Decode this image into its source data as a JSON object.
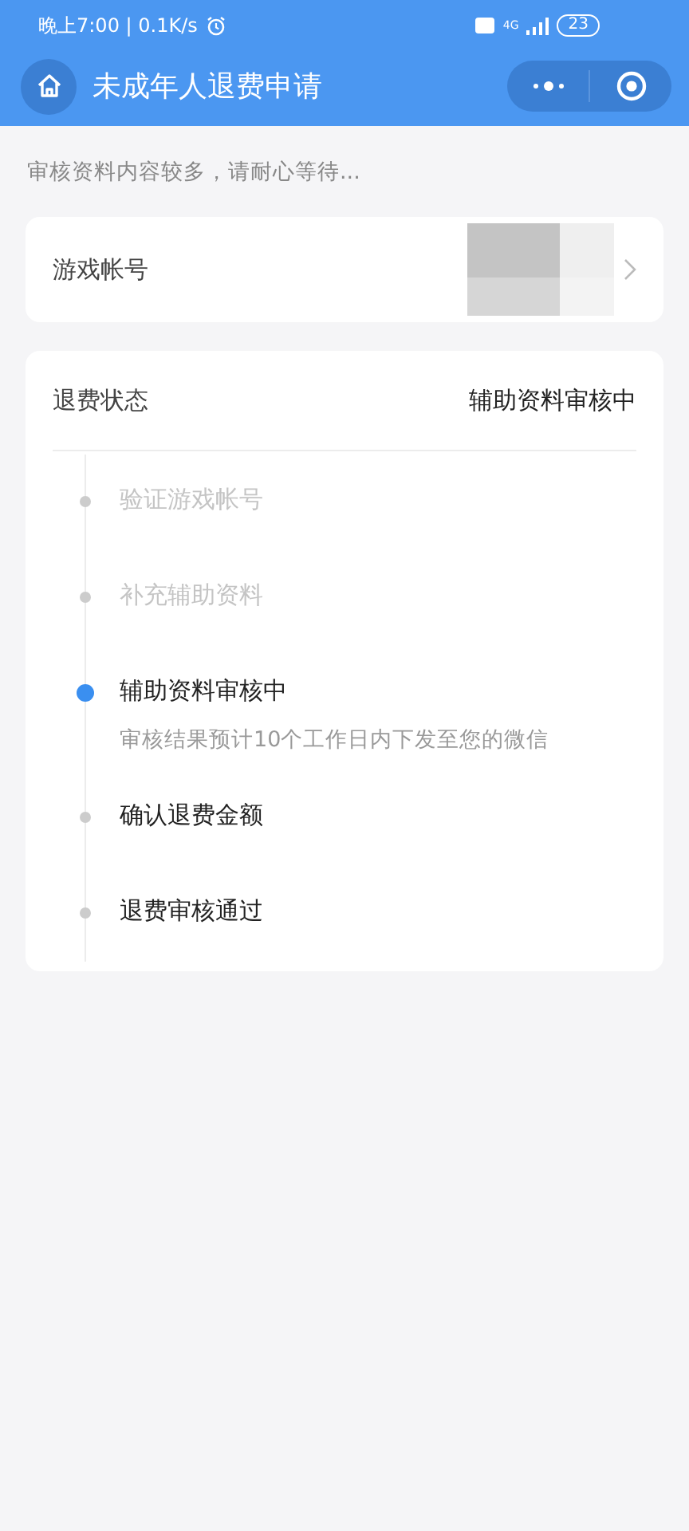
{
  "status_bar": {
    "time": "晚上7:00 | 0.1K/s",
    "network": "4G",
    "battery": "23"
  },
  "header": {
    "title": "未成年人退费申请"
  },
  "notice": "审核资料内容较多，请耐心等待...",
  "account": {
    "label": "游戏帐号"
  },
  "refund": {
    "label": "退费状态",
    "value": "辅助资料审核中",
    "steps": [
      {
        "title": "验证游戏帐号",
        "done": true,
        "selected": false
      },
      {
        "title": "补充辅助资料",
        "done": true,
        "selected": false
      },
      {
        "title": "辅助资料审核中",
        "done": false,
        "selected": true,
        "note": "审核结果预计10个工作日内下发至您的微信"
      },
      {
        "title": "确认退费金额",
        "done": false,
        "selected": false
      },
      {
        "title": "退费审核通过",
        "done": false,
        "selected": false
      }
    ]
  }
}
